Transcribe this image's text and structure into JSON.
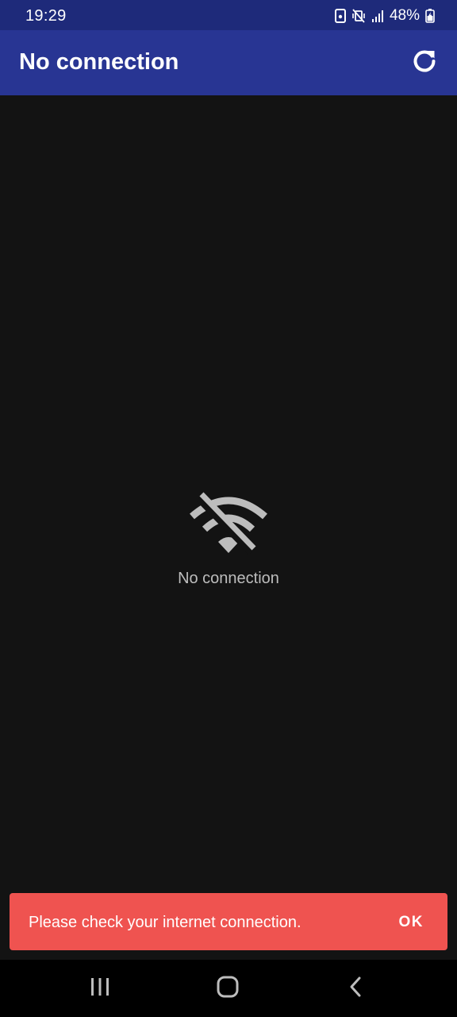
{
  "status_bar": {
    "time": "19:29",
    "battery_percent": "48%",
    "icons": [
      "lock-icon",
      "vibrate-mute-icon",
      "signal-icon",
      "battery-icon"
    ]
  },
  "app_bar": {
    "title": "No connection",
    "action_icon": "refresh-icon",
    "color": "#283593"
  },
  "empty_state": {
    "icon": "wifi-off-icon",
    "message": "No connection"
  },
  "snackbar": {
    "message": "Please check your internet connection.",
    "action_label": "OK",
    "color": "#ef5350"
  },
  "nav_bar": {
    "buttons": [
      "recents-icon",
      "home-icon",
      "back-icon"
    ]
  }
}
